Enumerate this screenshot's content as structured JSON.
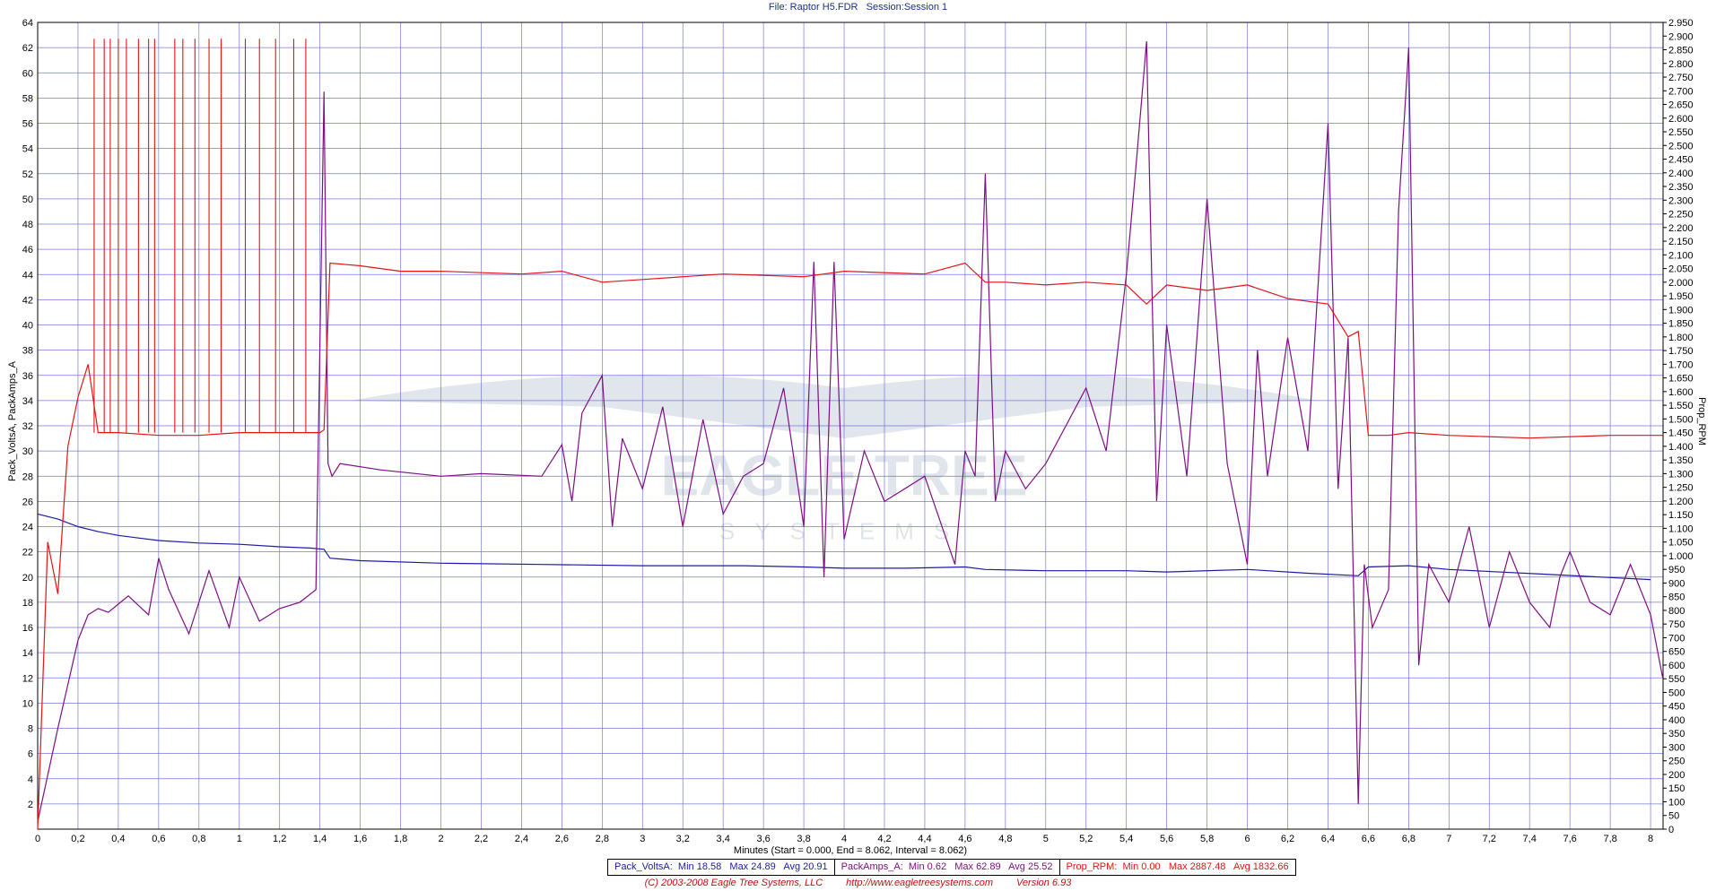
{
  "header": {
    "file_label": "File: Raptor H5.FDR",
    "session_label": "Session:Session 1"
  },
  "colors": {
    "volts": "#1a1aa8",
    "amps": "#7d0f82",
    "rpm": "#e21414",
    "grid": "#6a6ad6",
    "watermark": "#a9b4c8"
  },
  "watermark": {
    "main": "EAGLE TREE",
    "sub": "SYSTEMS"
  },
  "stats": {
    "volts": "Pack_VoltsA:  Min 18.58   Max 24.89   Avg 20.91",
    "amps": "PackAmps_A:  Min 0.62   Max 62.89   Avg 25.52",
    "rpm": "Prop_RPM:  Min 0.00   Max 2887.48   Avg 1832.66"
  },
  "footer": {
    "copyright": "(C) 2003-2008 Eagle Tree Systems, LLC",
    "url": "http://www.eagletreesystems.com",
    "version": "Version 6.93"
  },
  "chart_data": {
    "type": "line",
    "xlabel": "Minutes (Start = 0.000,  End = 8.062,  Interval =  8.062)",
    "ylabel_left": "Pack_VoltsA, PackAmps_A",
    "ylabel_right": "Prop_RPM",
    "xlim": [
      0,
      8.062
    ],
    "ylim_left": [
      0,
      64
    ],
    "ylim_right": [
      0,
      2950
    ],
    "x_ticks": [
      "0",
      "0,2",
      "0,4",
      "0,6",
      "0,8",
      "1",
      "1,2",
      "1,4",
      "1,6",
      "1,8",
      "2",
      "2,2",
      "2,4",
      "2,6",
      "2,8",
      "3",
      "3,2",
      "3,4",
      "3,6",
      "3,8",
      "4",
      "4,2",
      "4,4",
      "4,6",
      "4,8",
      "5",
      "5,2",
      "5,4",
      "5,6",
      "5,8",
      "6",
      "6,2",
      "6,4",
      "6,6",
      "6,8",
      "7",
      "7,2",
      "7,4",
      "7,6",
      "7,8",
      "8"
    ],
    "series": [
      {
        "name": "Pack_VoltsA",
        "axis": "left",
        "x": [
          0,
          0.1,
          0.2,
          0.3,
          0.4,
          0.5,
          0.6,
          0.8,
          1.0,
          1.2,
          1.35,
          1.42,
          1.45,
          1.6,
          2.0,
          2.5,
          3.0,
          3.5,
          3.8,
          4.0,
          4.3,
          4.6,
          4.7,
          5.0,
          5.4,
          5.6,
          6.0,
          6.3,
          6.55,
          6.6,
          6.8,
          7.0,
          7.5,
          8.0
        ],
        "y": [
          25.0,
          24.6,
          24.0,
          23.6,
          23.3,
          23.1,
          22.9,
          22.7,
          22.6,
          22.4,
          22.3,
          22.2,
          21.5,
          21.3,
          21.1,
          21.0,
          20.9,
          20.9,
          20.8,
          20.7,
          20.7,
          20.8,
          20.6,
          20.5,
          20.5,
          20.4,
          20.6,
          20.3,
          20.1,
          20.8,
          20.9,
          20.6,
          20.2,
          19.8
        ]
      },
      {
        "name": "PackAmps_A",
        "axis": "left",
        "x": [
          0,
          0.1,
          0.2,
          0.25,
          0.3,
          0.35,
          0.45,
          0.55,
          0.6,
          0.65,
          0.75,
          0.85,
          0.95,
          1.0,
          1.1,
          1.2,
          1.3,
          1.38,
          1.42,
          1.44,
          1.46,
          1.5,
          1.7,
          2.0,
          2.2,
          2.5,
          2.6,
          2.65,
          2.7,
          2.8,
          2.85,
          2.9,
          3.0,
          3.1,
          3.2,
          3.3,
          3.4,
          3.5,
          3.6,
          3.7,
          3.8,
          3.85,
          3.9,
          3.95,
          4.0,
          4.1,
          4.2,
          4.4,
          4.55,
          4.6,
          4.65,
          4.7,
          4.75,
          4.8,
          4.9,
          5.0,
          5.1,
          5.2,
          5.3,
          5.4,
          5.45,
          5.5,
          5.55,
          5.6,
          5.7,
          5.8,
          5.9,
          6.0,
          6.05,
          6.1,
          6.2,
          6.3,
          6.4,
          6.45,
          6.5,
          6.55,
          6.58,
          6.62,
          6.7,
          6.75,
          6.8,
          6.85,
          6.9,
          7.0,
          7.1,
          7.2,
          7.3,
          7.4,
          7.5,
          7.55,
          7.6,
          7.7,
          7.8,
          7.9,
          8.0,
          8.06
        ],
        "y": [
          0.6,
          8,
          15,
          17,
          17.5,
          17.2,
          18.5,
          17.0,
          21.5,
          19.0,
          15.5,
          20.5,
          16.0,
          20.0,
          16.5,
          17.5,
          18.0,
          19.0,
          58.5,
          29.0,
          28.0,
          29.0,
          28.5,
          28.0,
          28.2,
          28.0,
          30.5,
          26.0,
          33.0,
          36.0,
          24.0,
          31.0,
          27.0,
          33.5,
          24.0,
          32.5,
          25.0,
          28.0,
          29.0,
          35.0,
          24.0,
          45.0,
          20.0,
          45.0,
          23.0,
          30.0,
          26.0,
          28.0,
          21.0,
          30.0,
          28.0,
          52.0,
          26.0,
          30.0,
          27.0,
          29.0,
          32.0,
          35.0,
          30.0,
          44.0,
          53.0,
          62.5,
          26.0,
          40.0,
          28.0,
          50.0,
          29.0,
          21.0,
          38.0,
          28.0,
          39.0,
          30.0,
          56.0,
          27.0,
          39.0,
          2.0,
          21.0,
          16.0,
          19.0,
          49.0,
          62.0,
          13.0,
          21.0,
          18.0,
          24.0,
          16.0,
          22.0,
          18.0,
          16.0,
          20.0,
          22.0,
          18.0,
          17.0,
          21.0,
          17.0,
          12.0
        ]
      },
      {
        "name": "Prop_RPM",
        "axis": "right",
        "x": [
          0,
          0.05,
          0.1,
          0.15,
          0.2,
          0.25,
          0.3,
          0.4,
          0.6,
          0.8,
          1.0,
          1.2,
          1.4,
          1.42,
          1.45,
          1.6,
          1.8,
          2.0,
          2.4,
          2.6,
          2.8,
          3.0,
          3.4,
          3.8,
          4.0,
          4.4,
          4.6,
          4.7,
          4.8,
          5.0,
          5.2,
          5.4,
          5.5,
          5.6,
          5.8,
          6.0,
          6.2,
          6.4,
          6.5,
          6.55,
          6.6,
          6.7,
          6.8,
          7.0,
          7.4,
          7.8,
          8.06
        ],
        "y": [
          0,
          1050,
          860,
          1400,
          1580,
          1700,
          1450,
          1450,
          1440,
          1440,
          1450,
          1450,
          1450,
          1460,
          2070,
          2060,
          2040,
          2040,
          2030,
          2040,
          2000,
          2010,
          2030,
          2020,
          2040,
          2030,
          2070,
          2000,
          2000,
          1990,
          2000,
          1990,
          1920,
          1990,
          1970,
          1990,
          1940,
          1920,
          1800,
          1820,
          1440,
          1440,
          1450,
          1440,
          1430,
          1440,
          1440
        ]
      }
    ],
    "rpm_spikes": [
      0.28,
      0.33,
      0.36,
      0.4,
      0.44,
      0.5,
      0.55,
      0.58,
      0.68,
      0.72,
      0.78,
      0.85,
      0.91,
      1.03,
      1.1,
      1.18,
      1.27,
      1.33
    ],
    "grid": true
  }
}
